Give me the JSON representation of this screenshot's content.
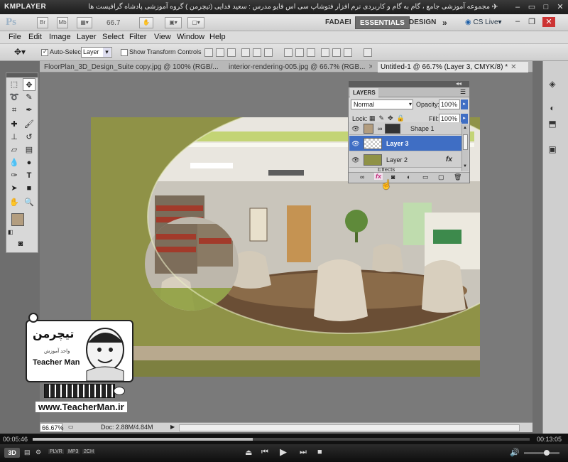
{
  "player": {
    "logo": "KMPLAYER",
    "caption": "مجموعه آموزشی جامع ، گام به گام و کاربردی نرم افزار فتوشاپ سی اس فایو  مدرس : سعید فدایی (تیچرمن ) گروه آموزشی پادشاه گرافیست ها",
    "time_elapsed": "00:05:46",
    "time_total": "00:13:05",
    "mode": "3D",
    "badges": [
      "PLVR",
      "MP3",
      "2CH"
    ]
  },
  "ps": {
    "logo": "Ps",
    "app_buttons": [
      "Br",
      "Mb"
    ],
    "zoom": "66.7",
    "workspaces": [
      "FADAEI",
      "ESSENTIALS",
      "DESIGN"
    ],
    "cs_live": "CS Live",
    "menu": [
      "File",
      "Edit",
      "Image",
      "Layer",
      "Select",
      "Filter",
      "View",
      "Window",
      "Help"
    ],
    "options": {
      "auto_select_label": "Auto-Select:",
      "auto_select_value": "Layer",
      "show_transform_label": "Show Transform Controls"
    },
    "tabs": [
      {
        "label": "FloorPlan_3D_Design_Suite copy.jpg @ 100% (RGB/...",
        "active": false
      },
      {
        "label": "interior-rendering-005.jpg @ 66.7% (RGB...",
        "active": false
      },
      {
        "label": "Untitled-1 @ 66.7% (Layer 3, CMYK/8) *",
        "active": true
      }
    ],
    "status": {
      "zoom": "66.67%",
      "doc": "Doc: 2.88M/4.84M"
    }
  },
  "layers_panel": {
    "title": "LAYERS",
    "blend_mode": "Normal",
    "opacity_label": "Opacity:",
    "opacity_value": "100%",
    "lock_label": "Lock:",
    "fill_label": "Fill:",
    "fill_value": "100%",
    "layers": [
      {
        "name": "Shape 1",
        "selected": false,
        "fx": false
      },
      {
        "name": "Layer 3",
        "selected": true,
        "fx": false
      },
      {
        "name": "Layer 2",
        "selected": false,
        "fx": true
      }
    ],
    "fx_label": "fx",
    "effects_label": "Effects"
  },
  "watermark": {
    "brand_fa": "تیچرمن",
    "tagline_fa": "واحد آموزش",
    "brand_en": "Teacher Man",
    "url": "www.TeacherMan.ir"
  },
  "colors": {
    "accent_layer_selected": "#3f6ec4",
    "artboard_olive": "#9a9c4b"
  }
}
